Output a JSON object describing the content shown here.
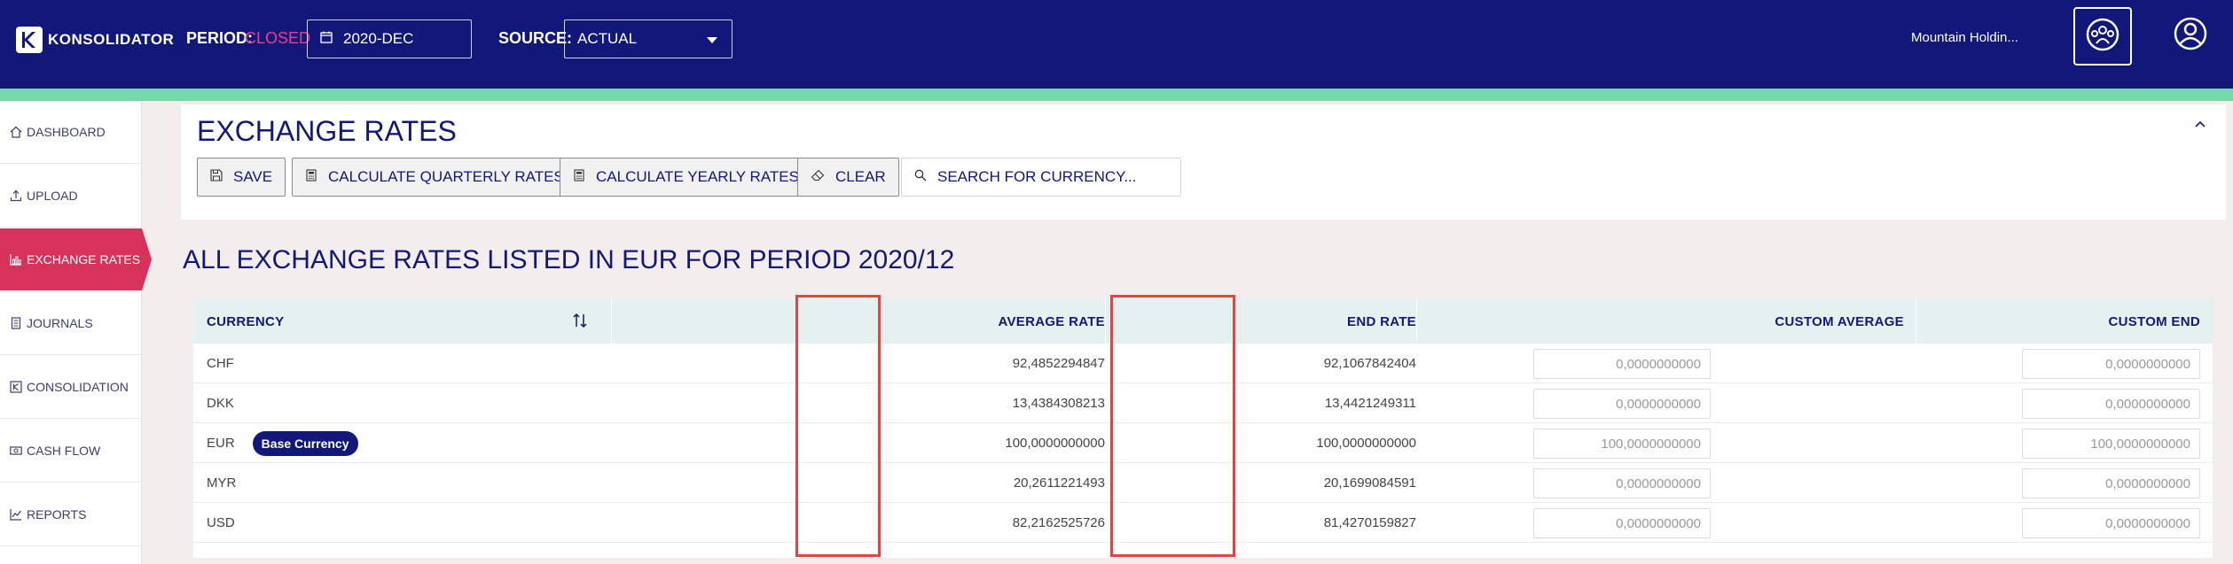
{
  "header": {
    "logo_text": "KONSOLIDATOR",
    "period_label": "PERIOD:",
    "period_status": "CLOSED",
    "period_value": "2020-DEC",
    "source_label": "SOURCE:",
    "source_value": "ACTUAL",
    "organization": "Mountain Holdin..."
  },
  "sidebar": {
    "items": [
      {
        "label": "DASHBOARD",
        "icon": "home-icon"
      },
      {
        "label": "UPLOAD",
        "icon": "upload-icon"
      },
      {
        "label": "EXCHANGE RATES",
        "icon": "bar-chart-icon",
        "active": true
      },
      {
        "label": "JOURNALS",
        "icon": "journal-icon"
      },
      {
        "label": "CONSOLIDATION",
        "icon": "consolidation-icon"
      },
      {
        "label": "CASH FLOW",
        "icon": "cash-icon"
      },
      {
        "label": "REPORTS",
        "icon": "line-chart-icon"
      }
    ]
  },
  "toolbar": {
    "title": "EXCHANGE RATES",
    "save_label": "SAVE",
    "quarterly_label": "CALCULATE QUARTERLY RATES",
    "yearly_label": "CALCULATE YEARLY RATES",
    "clear_label": "CLEAR",
    "search_placeholder": "SEARCH FOR CURRENCY..."
  },
  "section_heading": "ALL EXCHANGE RATES LISTED IN EUR FOR PERIOD 2020/12",
  "table": {
    "columns": {
      "currency": "CURRENCY",
      "average_rate": "AVERAGE RATE",
      "end_rate": "END RATE",
      "custom_average": "CUSTOM AVERAGE",
      "custom_end": "CUSTOM END"
    },
    "base_currency_badge": "Base Currency",
    "rows": [
      {
        "currency": "CHF",
        "average_rate": "92,4852294847",
        "end_rate": "92,1067842404",
        "custom_average": "0,0000000000",
        "custom_end": "0,0000000000"
      },
      {
        "currency": "DKK",
        "average_rate": "13,4384308213",
        "end_rate": "13,4421249311",
        "custom_average": "0,0000000000",
        "custom_end": "0,0000000000"
      },
      {
        "currency": "EUR",
        "average_rate": "100,0000000000",
        "end_rate": "100,0000000000",
        "custom_average": "100,0000000000",
        "custom_end": "100,0000000000"
      },
      {
        "currency": "MYR",
        "average_rate": "20,2611221493",
        "end_rate": "20,1699084591",
        "custom_average": "0,0000000000",
        "custom_end": "0,0000000000"
      },
      {
        "currency": "USD",
        "average_rate": "82,2162525726",
        "end_rate": "81,4270159827",
        "custom_average": "0,0000000000",
        "custom_end": "0,0000000000"
      }
    ]
  },
  "colors": {
    "header_bg": "#12187a",
    "accent_strip": "#74d9a9",
    "active_nav": "#d6325a",
    "closed_status": "#e8418a",
    "highlight_border": "#e14540"
  }
}
